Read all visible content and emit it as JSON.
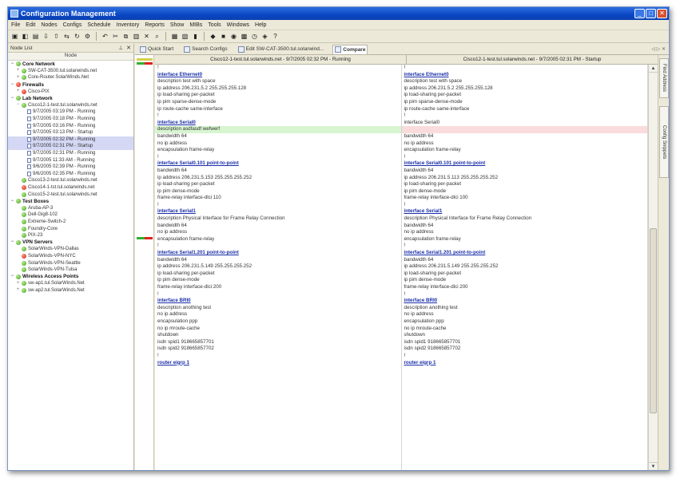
{
  "window": {
    "title": "Configuration Management"
  },
  "menu": [
    "File",
    "Edit",
    "Nodes",
    "Configs",
    "Schedule",
    "Inventory",
    "Reports",
    "Show",
    "MIBs",
    "Tools",
    "Windows",
    "Help"
  ],
  "left_pane": {
    "title": "Node List",
    "column": "Node",
    "rows": [
      {
        "label": "Core Network",
        "level": 0,
        "type": "cat",
        "status": "g",
        "exp": "−"
      },
      {
        "label": "SW-CAT-3500.tul.solarwinds.net",
        "level": 1,
        "type": "node",
        "status": "g",
        "exp": "+"
      },
      {
        "label": "Core-Router.SolarWinds.Net",
        "level": 1,
        "type": "node",
        "status": "g",
        "exp": "+"
      },
      {
        "label": "Firewalls",
        "level": 0,
        "type": "cat",
        "status": "r",
        "exp": "−"
      },
      {
        "label": "Cisco-PIX",
        "level": 1,
        "type": "node",
        "status": "r",
        "exp": "+"
      },
      {
        "label": "Lab Network",
        "level": 0,
        "type": "cat",
        "status": "g",
        "exp": "−"
      },
      {
        "label": "Cisco12-1-test.tul.solarwinds.net",
        "level": 1,
        "type": "node",
        "status": "g",
        "exp": "−"
      },
      {
        "label": "9/7/2005 03:19 PM - Running",
        "level": 2,
        "type": "doc"
      },
      {
        "label": "9/7/2005 03:18 PM - Running",
        "level": 2,
        "type": "doc"
      },
      {
        "label": "9/7/2005 03:16 PM - Running",
        "level": 2,
        "type": "doc"
      },
      {
        "label": "9/7/2005 03:13 PM - Startup",
        "level": 2,
        "type": "doc"
      },
      {
        "label": "9/7/2005 02:32 PM - Running",
        "level": 2,
        "type": "doc",
        "sel": true
      },
      {
        "label": "9/7/2005 02:31 PM - Startup",
        "level": 2,
        "type": "doc",
        "sel": true
      },
      {
        "label": "9/7/2005 02:31 PM - Running",
        "level": 2,
        "type": "doc"
      },
      {
        "label": "9/7/2005 11:33 AM - Running",
        "level": 2,
        "type": "doc"
      },
      {
        "label": "9/6/2005 02:39 PM - Running",
        "level": 2,
        "type": "doc"
      },
      {
        "label": "9/6/2005 02:35 PM - Running",
        "level": 2,
        "type": "doc"
      },
      {
        "label": "Cisco13-2-test.tul.solarwinds.net",
        "level": 1,
        "type": "node",
        "status": "g"
      },
      {
        "label": "Cisco14-1-tst.tul.solarwinds.net",
        "level": 1,
        "type": "node",
        "status": "r"
      },
      {
        "label": "Cisco15-2-test.tul.solarwinds.net",
        "level": 1,
        "type": "node",
        "status": "g"
      },
      {
        "label": "Test Boxes",
        "level": 0,
        "type": "cat",
        "status": "g",
        "exp": "−"
      },
      {
        "label": "Aruba-AP-3",
        "level": 1,
        "type": "node",
        "status": "g"
      },
      {
        "label": "Dell-Gig8-102",
        "level": 1,
        "type": "node",
        "status": "g"
      },
      {
        "label": "Extreme-Switch-2",
        "level": 1,
        "type": "node",
        "status": "g"
      },
      {
        "label": "Foundry-Core",
        "level": 1,
        "type": "node",
        "status": "g"
      },
      {
        "label": "PIX-23",
        "level": 1,
        "type": "node",
        "status": "g"
      },
      {
        "label": "VPN Servers",
        "level": 0,
        "type": "cat",
        "status": "g",
        "exp": "−"
      },
      {
        "label": "SolarWinds-VPN-Dallas",
        "level": 1,
        "type": "node",
        "status": "g"
      },
      {
        "label": "SolarWinds-VPN-NYC",
        "level": 1,
        "type": "node",
        "status": "r"
      },
      {
        "label": "SolarWinds-VPN-Seattle",
        "level": 1,
        "type": "node",
        "status": "g"
      },
      {
        "label": "SolarWinds-VPN-Tulsa",
        "level": 1,
        "type": "node",
        "status": "g"
      },
      {
        "label": "Wireless Access Points",
        "level": 0,
        "type": "cat",
        "status": "g",
        "exp": "−"
      },
      {
        "label": "sw-ap1.tul.SolarWinds.Net",
        "level": 1,
        "type": "node",
        "status": "g",
        "exp": "+"
      },
      {
        "label": "sw-ap2.tul.SolarWinds.Net",
        "level": 1,
        "type": "node",
        "status": "g",
        "exp": "+"
      }
    ]
  },
  "tabs": [
    {
      "label": "Quick Start",
      "active": false
    },
    {
      "label": "Search Configs",
      "active": false
    },
    {
      "label": "Edit SW-CAT-3500.tul.solarwind...",
      "active": false
    },
    {
      "label": "Compare",
      "active": true
    }
  ],
  "side_tabs": [
    "Find Address",
    "Config Snippets"
  ],
  "compare": {
    "left_header": "Cisco12-1-test.tul.solarwinds.net - 9/7/2005 02:32 PM - Running",
    "right_header": "Cisco12-1-test.tul.solarwinds.net - 9/7/2005 02:31 PM - Startup",
    "left_lines": [
      {
        "t": "!"
      },
      {
        "t": "interface Ethernet0",
        "k": "hdr"
      },
      {
        "t": "description test with space"
      },
      {
        "t": "ip address 206.231.5.2 255.255.255.128"
      },
      {
        "t": "ip load-sharing per-packet"
      },
      {
        "t": "ip pim sparse-dense-mode"
      },
      {
        "t": "ip route-cache same-interface"
      },
      {
        "t": "!"
      },
      {
        "t": "interface Serial0",
        "k": "hdr"
      },
      {
        "t": "description asdfasdf wefwerf",
        "k": "addg"
      },
      {
        "t": "bandwidth 64"
      },
      {
        "t": "no ip address"
      },
      {
        "t": "encapsulation frame-relay"
      },
      {
        "t": "!"
      },
      {
        "t": "interface Serial0.101 point-to-point",
        "k": "hdr"
      },
      {
        "t": "bandwidth 64"
      },
      {
        "t": "ip address 206.231.5.153 255.255.255.252"
      },
      {
        "t": "ip load-sharing per-packet"
      },
      {
        "t": "ip pim dense-mode"
      },
      {
        "t": "frame-relay interface-dlci 110"
      },
      {
        "t": "!"
      },
      {
        "t": "interface Serial1",
        "k": "hdr"
      },
      {
        "t": "description Physical Interface for Frame Relay Connection"
      },
      {
        "t": "bandwidth 64"
      },
      {
        "t": "no ip address"
      },
      {
        "t": "encapsulation frame-relay"
      },
      {
        "t": "!"
      },
      {
        "t": "interface Serial1.201 point-to-point",
        "k": "hdr"
      },
      {
        "t": "bandwidth 64"
      },
      {
        "t": "ip address 206.231.5.149 255.255.255.252"
      },
      {
        "t": "ip load-sharing per-packet"
      },
      {
        "t": "ip pim dense-mode"
      },
      {
        "t": "frame-relay interface-dlci 200"
      },
      {
        "t": "!"
      },
      {
        "t": "interface BRI0",
        "k": "hdr"
      },
      {
        "t": "description anothing test"
      },
      {
        "t": "no ip address"
      },
      {
        "t": "encapsulation ppp"
      },
      {
        "t": "no ip mroute-cache"
      },
      {
        "t": "shutdown"
      },
      {
        "t": "isdn spid1 918665857701"
      },
      {
        "t": "isdn spid2 918665857702"
      },
      {
        "t": "!"
      },
      {
        "t": "router eigrp 1",
        "k": "hdr"
      }
    ],
    "right_lines": [
      {
        "t": "!"
      },
      {
        "t": "interface Ethernet0",
        "k": "hdr"
      },
      {
        "t": "description test with space"
      },
      {
        "t": "ip address 206.231.5.2 255.255.255.128"
      },
      {
        "t": "ip load-sharing per-packet"
      },
      {
        "t": "ip pim sparse-dense-mode"
      },
      {
        "t": "ip route-cache same-interface"
      },
      {
        "t": "!"
      },
      {
        "t": "interface Serial0"
      },
      {
        "t": "",
        "k": "addr"
      },
      {
        "t": "bandwidth 64"
      },
      {
        "t": "no ip address"
      },
      {
        "t": "encapsulation frame-relay"
      },
      {
        "t": "!"
      },
      {
        "t": "interface Serial0.101 point-to-point",
        "k": "hdr"
      },
      {
        "t": "bandwidth 64"
      },
      {
        "t": "ip address 206.231.5.113 255.255.255.252"
      },
      {
        "t": "ip load-sharing per-packet"
      },
      {
        "t": "ip pim dense-mode"
      },
      {
        "t": "frame-relay interface-dlci 100"
      },
      {
        "t": "!"
      },
      {
        "t": "interface Serial1",
        "k": "hdr"
      },
      {
        "t": "description Physical Interface for Frame Relay Connection"
      },
      {
        "t": "bandwidth 64"
      },
      {
        "t": "no ip address"
      },
      {
        "t": "encapsulation frame-relay"
      },
      {
        "t": "!"
      },
      {
        "t": "interface Serial1.201 point-to-point",
        "k": "hdr"
      },
      {
        "t": "bandwidth 64"
      },
      {
        "t": "ip address 206.231.5.149 255.255.255.252"
      },
      {
        "t": "ip load-sharing per-packet"
      },
      {
        "t": "ip pim dense-mode"
      },
      {
        "t": "frame-relay interface-dlci 200"
      },
      {
        "t": "!"
      },
      {
        "t": "interface BRI0",
        "k": "hdr"
      },
      {
        "t": "description anothing test"
      },
      {
        "t": "no ip address"
      },
      {
        "t": "encapsulation ppp"
      },
      {
        "t": "no ip mroute-cache"
      },
      {
        "t": "shutdown"
      },
      {
        "t": "isdn spid1 918665857701"
      },
      {
        "t": "isdn spid2 918665857702"
      },
      {
        "t": "!"
      },
      {
        "t": "router eigrp 1",
        "k": "hdr"
      }
    ]
  }
}
